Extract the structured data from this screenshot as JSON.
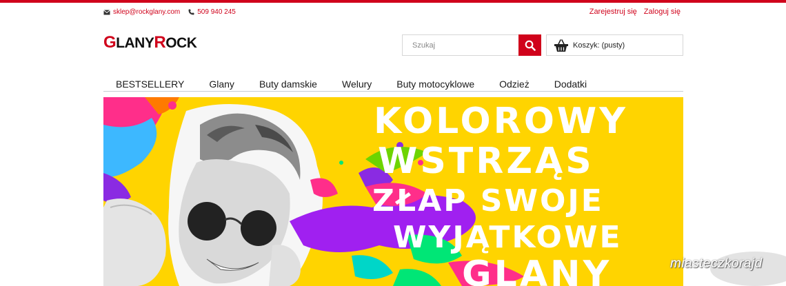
{
  "contact": {
    "email": "sklep@rockglany.com",
    "phone": "509 940 245"
  },
  "auth": {
    "register": "Zarejestruj się",
    "login": "Zaloguj się"
  },
  "logo": {
    "part1_initial": "G",
    "part1_rest": "LANY",
    "part2_initial": "R",
    "part2_rest": "OCK"
  },
  "search": {
    "placeholder": "Szukaj"
  },
  "cart": {
    "label": "Koszyk: (pusty)"
  },
  "nav": {
    "items": [
      "BESTSELLERY",
      "Glany",
      "Buty damskie",
      "Welury",
      "Buty motocyklowe",
      "Odzież",
      "Dodatki"
    ]
  },
  "banner": {
    "lines": [
      "KOLOROWY",
      "WSTRZĄS",
      "ZŁAP SWOJE",
      "WYJĄTKOWE",
      "GLANY"
    ]
  },
  "watermark": "miasteczkorajd",
  "colors": {
    "accent": "#d0021b",
    "banner_bg": "#ffd400"
  }
}
